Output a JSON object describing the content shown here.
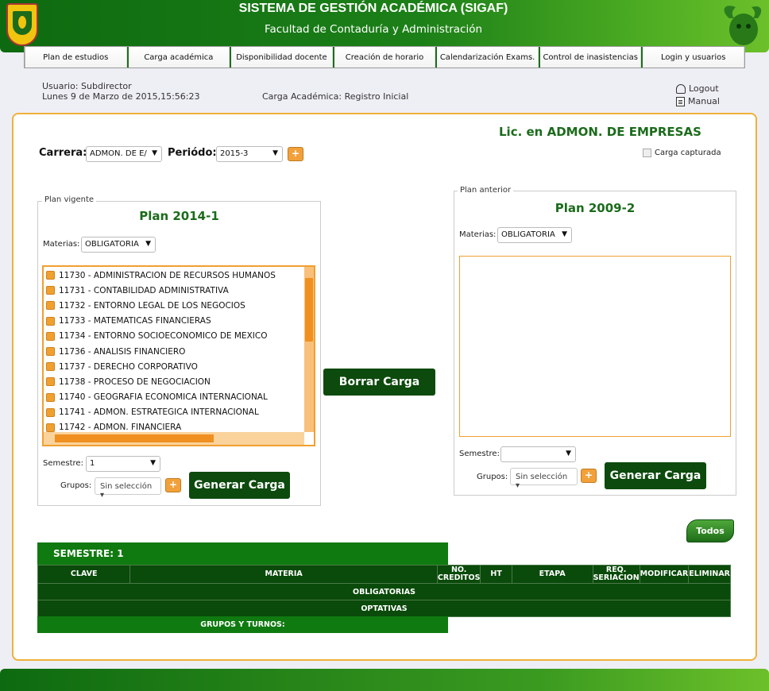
{
  "header": {
    "title": "SISTEMA DE GESTIÓN ACADÉMICA (SIGAF)",
    "subtitle": "Facultad de Contaduría y Administración"
  },
  "nav": [
    "Plan de estudios",
    "Carga académica",
    "Disponibilidad docente",
    "Creación de horario",
    "Calendarización Exams.",
    "Control de inasistencias",
    "Login y usuarios"
  ],
  "info": {
    "user": "Usuario: Subdirector",
    "datetime": "Lunes 9 de Marzo de 2015,15:56:23",
    "carga": "Carga Académica: Registro Inicial",
    "logout": "Logout",
    "manual": "Manual"
  },
  "career_title": "Lic. en ADMON. DE EMPRESAS",
  "filters": {
    "carrera_label": "Carrera:",
    "carrera_value": "ADMON. DE E/",
    "periodo_label": "Periódo:",
    "periodo_value": "2015-3",
    "carga_capturada": "Carga capturada"
  },
  "plan_vigente": {
    "legend": "Plan vigente",
    "title": "Plan 2014-1",
    "materias_label": "Materias:",
    "materias_value": "OBLIGATORIA",
    "items": [
      "11730 - ADMINISTRACION DE RECURSOS HUMANOS",
      "11731 - CONTABILIDAD ADMINISTRATIVA",
      "11732 - ENTORNO LEGAL DE LOS NEGOCIOS",
      "11733 - MATEMATICAS FINANCIERAS",
      "11734 - ENTORNO SOCIOECONOMICO DE MEXICO",
      "11736 - ANALISIS FINANCIERO",
      "11737 - DERECHO CORPORATIVO",
      "11738 - PROCESO DE NEGOCIACION",
      "11740 - GEOGRAFIA ECONOMICA INTERNACIONAL",
      "11741 - ADMON. ESTRATEGICA INTERNACIONAL",
      "11742 - ADMON. FINANCIERA"
    ],
    "semestre_label": "Semestre:",
    "semestre_value": "1",
    "grupos_label": "Grupos:",
    "grupos_value": "Sin selección",
    "generar": "Generar Carga"
  },
  "borrar": "Borrar Carga",
  "plan_anterior": {
    "legend": "Plan anterior",
    "title": "Plan 2009-2",
    "materias_label": "Materias:",
    "materias_value": "OBLIGATORIA",
    "semestre_label": "Semestre:",
    "semestre_value": "",
    "grupos_label": "Grupos:",
    "grupos_value": "Sin selección",
    "generar": "Generar Carga"
  },
  "todos": "Todos",
  "table": {
    "semestre": "SEMESTRE: 1",
    "headers": [
      "CLAVE",
      "MATERIA",
      "NO. CREDITOS",
      "HT",
      "ETAPA",
      "REQ. SERIACION",
      "MODIFICAR",
      "ELIMINAR"
    ],
    "obligatorias": "OBLIGATORIAS",
    "optativas": "OPTATIVAS",
    "grupos_turnos": "GRUPOS Y TURNOS:"
  },
  "colors": {
    "primary_green": "#0a4a0a",
    "accent_orange": "#f0a030"
  },
  "icons": {
    "logout": "user-icon",
    "manual": "document-icon"
  }
}
